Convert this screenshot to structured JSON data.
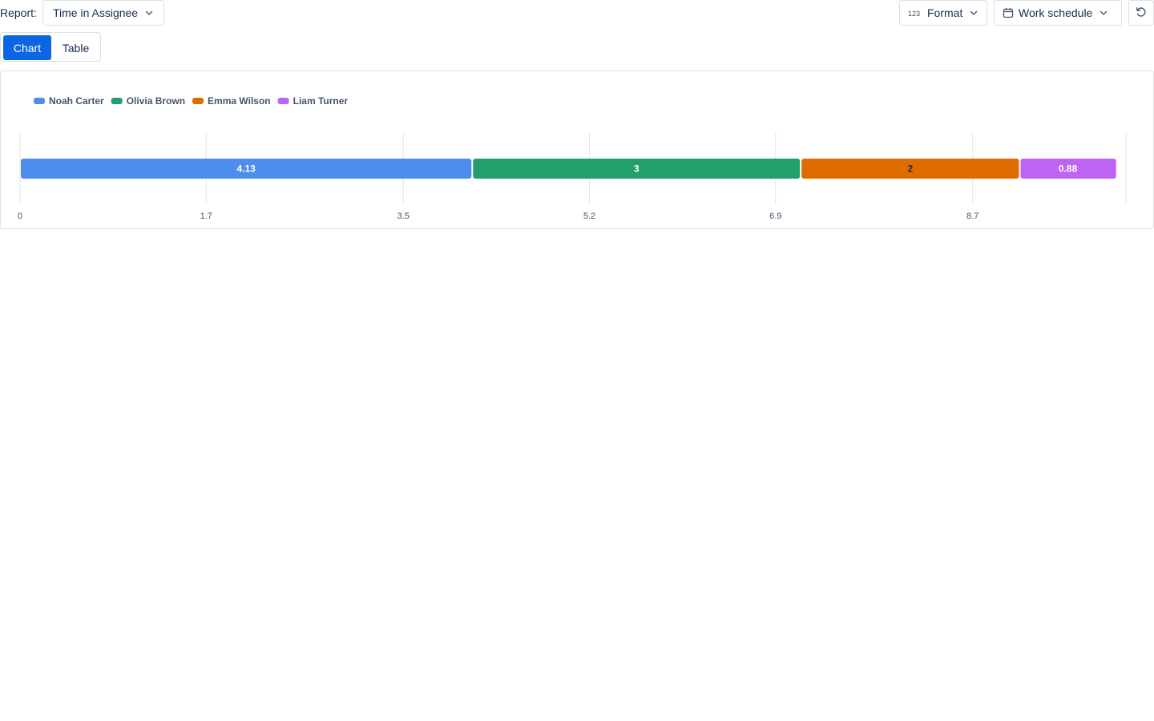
{
  "toolbar": {
    "report_label": "Report:",
    "report_value": "Time in Assignee",
    "format_label": "Format",
    "schedule_label": "Work schedule",
    "format_icon": "number-format-icon",
    "schedule_icon": "calendar-icon",
    "reset_icon": "reset-icon"
  },
  "view_tabs": {
    "chart": "Chart",
    "table": "Table",
    "active": "Chart"
  },
  "colors": {
    "accent": "#0c66e4",
    "noah": "#4c8ded",
    "olivia": "#22a06b",
    "emma": "#e06c00",
    "liam": "#bf63f3"
  },
  "chart_data": {
    "type": "bar",
    "orientation": "horizontal-stacked",
    "categories": [
      ""
    ],
    "series": [
      {
        "name": "Noah Carter",
        "values": [
          4.13
        ],
        "color": "#4c8ded",
        "label": "4.13",
        "label_color": "#ffffff"
      },
      {
        "name": "Olivia Brown",
        "values": [
          3
        ],
        "color": "#22a06b",
        "label": "3",
        "label_color": "#ffffff"
      },
      {
        "name": "Emma Wilson",
        "values": [
          2
        ],
        "color": "#e06c00",
        "label": "2",
        "label_color": "#172b4d"
      },
      {
        "name": "Liam Turner",
        "values": [
          0.88
        ],
        "color": "#bf63f3",
        "label": "0.88",
        "label_color": "#ffffff"
      }
    ],
    "x_ticks": [
      "0",
      "1.7",
      "3.5",
      "5.2",
      "6.9",
      "8.7"
    ],
    "x_tick_values": [
      0,
      1.7,
      3.5,
      5.2,
      6.9,
      8.7
    ],
    "xlim": [
      0,
      10.1
    ],
    "grid": true,
    "legend_position": "top-left"
  }
}
